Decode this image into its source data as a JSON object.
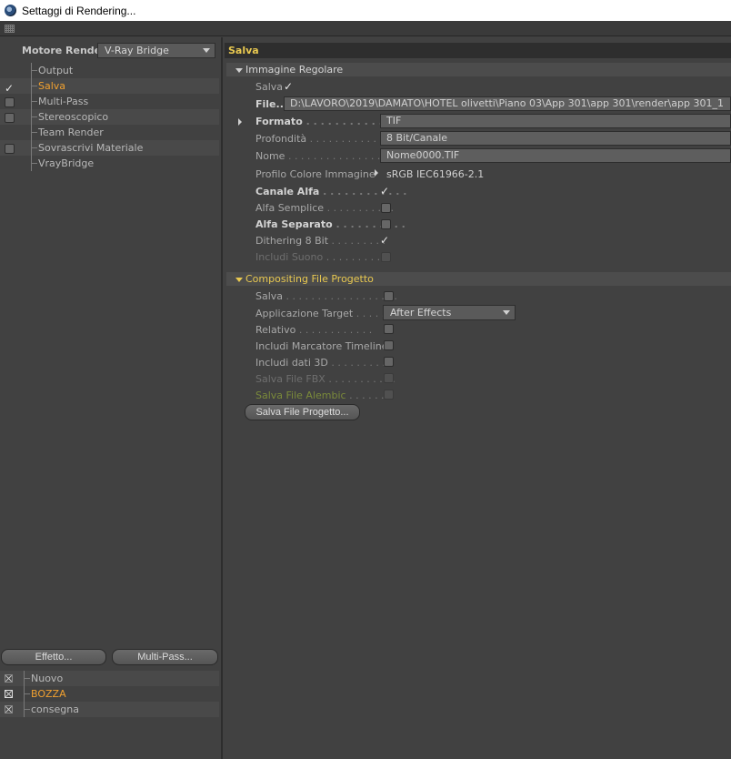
{
  "window": {
    "title": "Settaggi di Rendering..."
  },
  "left": {
    "engine_label": "Motore Render",
    "engine_value": "V-Ray Bridge",
    "tree": [
      {
        "label": "Output",
        "checkbox": "none"
      },
      {
        "label": "Salva",
        "checkbox": "checked",
        "active": true
      },
      {
        "label": "Multi-Pass",
        "checkbox": "unchecked"
      },
      {
        "label": "Stereoscopico",
        "checkbox": "unchecked"
      },
      {
        "label": "Team Render",
        "checkbox": "none"
      },
      {
        "label": "Sovrascrivi Materiale",
        "checkbox": "unchecked"
      },
      {
        "label": "VrayBridge",
        "checkbox": "none"
      }
    ],
    "effect_button": "Effetto...",
    "multipass_button": "Multi-Pass...",
    "render_settings": [
      {
        "label": "Nuovo"
      },
      {
        "label": "BOZZA",
        "active": true
      },
      {
        "label": "consegna"
      }
    ]
  },
  "right": {
    "section_title": "Salva",
    "regular_group": "Immagine Regolare",
    "save_label": "Salva",
    "file_label": "File...",
    "file_value": "D:\\LAVORO\\2019\\DAMATO\\HOTEL olivetti\\Piano 03\\App 301\\app 301\\render\\app 301_1",
    "format_label": "Formato",
    "format_value": "TIF",
    "depth_label": "Profondità",
    "depth_value": "8 Bit/Canale",
    "name_label": "Nome",
    "name_value": "Nome0000.TIF",
    "profile_label": "Profilo Colore Immagine",
    "profile_value": "sRGB IEC61966-2.1",
    "alpha_label": "Canale Alfa",
    "straight_alpha_label": "Alfa Semplice",
    "separate_alpha_label": "Alfa Separato",
    "dithering_label": "Dithering 8 Bit",
    "sound_label": "Includi Suono",
    "compositing_group": "Compositing File Progetto",
    "comp_save_label": "Salva",
    "target_app_label": "Applicazione Target",
    "target_app_value": "After Effects",
    "relative_label": "Relativo",
    "timeline_label": "Includi Marcatore Timeline",
    "data3d_label": "Includi dati 3D",
    "fbx_label": "Salva File FBX",
    "alembic_label": "Salva File Alembic",
    "save_project_button": "Salva File Progetto..."
  }
}
